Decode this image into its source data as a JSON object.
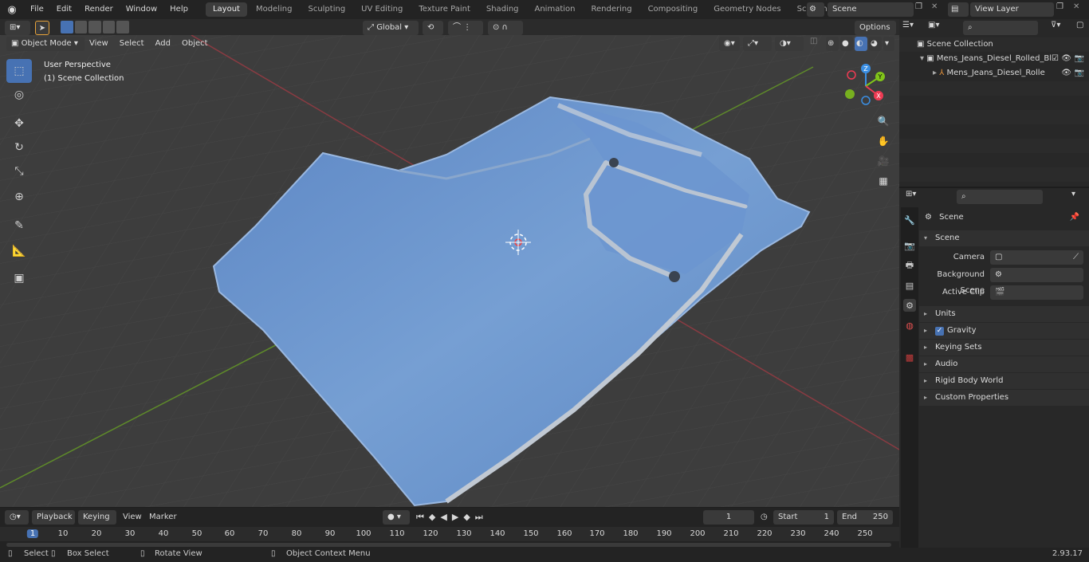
{
  "top_menu": [
    "File",
    "Edit",
    "Render",
    "Window",
    "Help"
  ],
  "workspace_tabs": [
    "Layout",
    "Modeling",
    "Sculpting",
    "UV Editing",
    "Texture Paint",
    "Shading",
    "Animation",
    "Rendering",
    "Compositing",
    "Geometry Nodes",
    "Scripting"
  ],
  "active_tab": "Layout",
  "scene_name": "Scene",
  "view_layer": "View Layer",
  "viewport_header": {
    "mode": "Object Mode",
    "menus": [
      "View",
      "Select",
      "Add",
      "Object"
    ],
    "transform_orientation": "Global",
    "options": "Options"
  },
  "viewport_overlay": {
    "perspective": "User Perspective",
    "collection": "(1) Scene Collection"
  },
  "gizmo_axes": {
    "z": "Z",
    "y": "Y",
    "x": "X"
  },
  "outliner": {
    "root": "Scene Collection",
    "items": [
      {
        "label": "Mens_Jeans_Diesel_Rolled_Bl"
      },
      {
        "label": "Mens_Jeans_Diesel_Rolle"
      }
    ]
  },
  "properties": {
    "context": "Scene",
    "section": "Scene",
    "fields": [
      {
        "label": "Camera"
      },
      {
        "label": "Background Scene"
      },
      {
        "label": "Active Clip"
      }
    ],
    "panels": [
      "Units",
      "Gravity",
      "Keying Sets",
      "Audio",
      "Rigid Body World",
      "Custom Properties"
    ]
  },
  "timeline": {
    "menus": [
      "Playback",
      "Keying",
      "View",
      "Marker"
    ],
    "current_frame": "1",
    "start_label": "Start",
    "start": "1",
    "end_label": "End",
    "end": "250",
    "ruler": [
      "1",
      "10",
      "20",
      "30",
      "40",
      "50",
      "60",
      "70",
      "80",
      "90",
      "100",
      "110",
      "120",
      "130",
      "140",
      "150",
      "160",
      "170",
      "180",
      "190",
      "200",
      "210",
      "220",
      "230",
      "240",
      "250"
    ]
  },
  "statusbar": {
    "select": "Select",
    "box_select": "Box Select",
    "rotate": "Rotate View",
    "context_menu": "Object Context Menu",
    "version": "2.93.17"
  },
  "colors": {
    "accent": "#4772b3",
    "x_axis": "#ee3b53",
    "y_axis": "#81c41a",
    "z_axis": "#3b8fe3",
    "denim": "#6f9bd0"
  }
}
